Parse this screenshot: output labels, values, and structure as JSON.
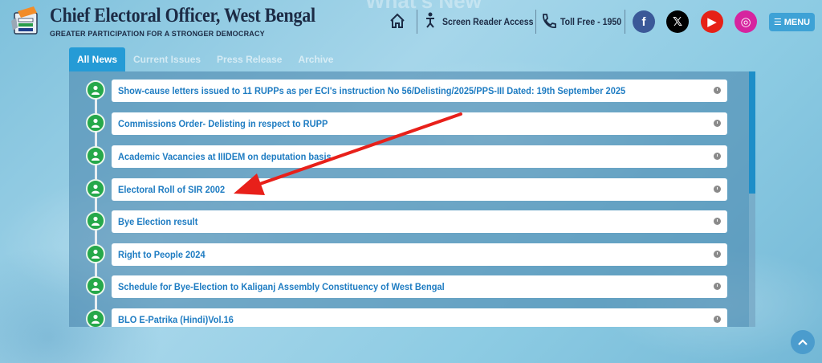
{
  "header": {
    "title": "Chief Electoral Officer, West Bengal",
    "tagline": "GREATER PARTICIPATION FOR A STRONGER DEMOCRACY",
    "ghost_heading": "What's New",
    "screen_reader": "Screen Reader Access",
    "toll_free": "Toll Free - 1950",
    "menu_label": "MENU",
    "menu_icon": "☰",
    "social": [
      {
        "name": "facebook-icon",
        "glyph": "f",
        "color": "#3b5998"
      },
      {
        "name": "x-icon",
        "glyph": "𝕏",
        "color": "#000000"
      },
      {
        "name": "youtube-icon",
        "glyph": "▶",
        "color": "#e62117"
      },
      {
        "name": "instagram-icon",
        "glyph": "◎",
        "color": "#d6249f"
      }
    ]
  },
  "tabs": [
    {
      "label": "All News",
      "active": true
    },
    {
      "label": "Current Issues",
      "active": false
    },
    {
      "label": "Press Release",
      "active": false
    },
    {
      "label": "Archive",
      "active": false
    }
  ],
  "news": [
    "Show-cause letters issued to 11 RUPPs as per ECI's instruction No 56/Delisting/2025/PPS-III Dated: 19th September 2025",
    "Commissions Order- Delisting in respect to RUPP",
    "Academic Vacancies at IIIDEM on deputation basis",
    "Electoral Roll of SIR 2002",
    "Bye Election result",
    "Right to People 2024",
    "Schedule for Bye-Election to Kaliganj Assembly Constituency of West Bengal",
    "BLO E-Patrika (Hindi)Vol.16"
  ],
  "colors": {
    "accent": "#259bd6",
    "link": "#1e7cc2",
    "timeline_dot": "#26a84a",
    "annotation_arrow": "#e8201a"
  }
}
